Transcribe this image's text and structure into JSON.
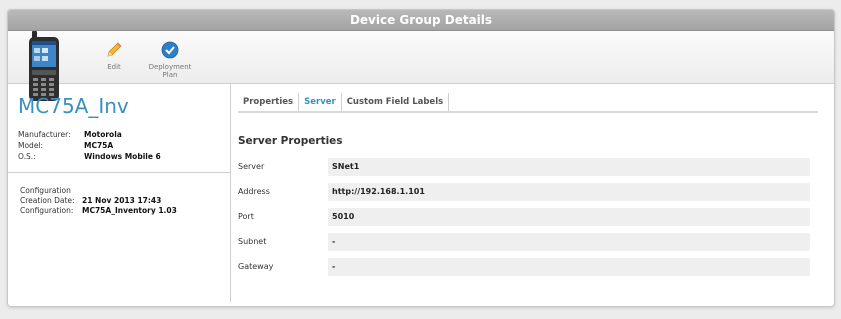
{
  "window": {
    "title": "Device Group Details"
  },
  "toolbar": {
    "device_image": "mobile-device-image",
    "buttons": [
      {
        "label": "Edit",
        "icon": "pencil-icon"
      },
      {
        "label": "Deployment Plan",
        "icon": "checkmark-icon"
      }
    ]
  },
  "device": {
    "name": "MC75A_Inv",
    "properties": [
      {
        "key": "Manufacturer:",
        "value": "Motorola"
      },
      {
        "key": "Model:",
        "value": "MC75A"
      },
      {
        "key": "O.S.:",
        "value": "Windows Mobile 6"
      }
    ],
    "config": {
      "heading": "Configuration",
      "rows": [
        {
          "key": "Creation Date:",
          "value": "21 Nov 2013 17:43"
        },
        {
          "key": "Configuration:",
          "value": "MC75A_Inventory 1.03"
        }
      ]
    }
  },
  "tabs": [
    {
      "label": "Properties",
      "active": false
    },
    {
      "label": "Server",
      "active": true
    },
    {
      "label": "Custom Field Labels",
      "active": false
    }
  ],
  "server": {
    "section_title": "Server Properties",
    "fields": [
      {
        "label": "Server",
        "value": "SNet1"
      },
      {
        "label": "Address",
        "value": "http://192.168.1.101"
      },
      {
        "label": "Port",
        "value": "5010"
      },
      {
        "label": "Subnet",
        "value": "-"
      },
      {
        "label": "Gateway",
        "value": "-"
      }
    ]
  },
  "colors": {
    "accent": "#3b8fc0",
    "titlebar": "#a8a8a8"
  }
}
